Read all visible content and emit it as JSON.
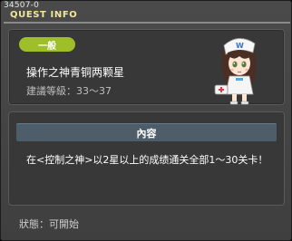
{
  "window": {
    "quest_id": "34507-0",
    "title": "QUEST INFO"
  },
  "quest": {
    "category_badge": "一般",
    "name": "操作之神青铜两颗星",
    "level_requirement": "建議等級：33～37",
    "npc_image": "nurse-npc-with-cap"
  },
  "content": {
    "header": "內容",
    "description": "在<控制之神>以2星以上的成绩通关全部1～30关卡！"
  },
  "footer": {
    "status": "狀態：可開始"
  },
  "colors": {
    "title_text": "#f2e79a",
    "badge_green": "#9fbf2a",
    "content_header_bg": "#4d5d6a",
    "panel_bg": "#383838",
    "window_bg": "#454545"
  }
}
